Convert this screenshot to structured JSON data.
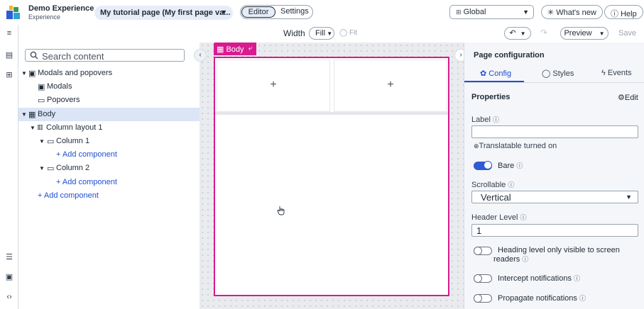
{
  "header": {
    "app_title": "Demo Experience",
    "app_subtitle": "Experience",
    "page_select": "My tutorial page (My first page va...",
    "tabs": [
      "Editor",
      "Settings"
    ],
    "global_select": "Global",
    "whats_new": "What's new",
    "help": "Help"
  },
  "toolbar": {
    "width_label": "Width",
    "width_value": "Fill",
    "fit_label": "Fit",
    "preview": "Preview",
    "save": "Save"
  },
  "tree": {
    "search_placeholder": "Search content",
    "items": [
      {
        "label": "Modals and popovers"
      },
      {
        "label": "Modals"
      },
      {
        "label": "Popovers"
      },
      {
        "label": "Body"
      },
      {
        "label": "Column layout 1"
      },
      {
        "label": "Column 1"
      },
      {
        "label": "+ Add component"
      },
      {
        "label": "Column 2"
      },
      {
        "label": "+ Add component"
      },
      {
        "label": "+ Add component"
      }
    ]
  },
  "canvas": {
    "body_tag": "Body",
    "plus": "+"
  },
  "config": {
    "title": "Page configuration",
    "tabs": [
      "Config",
      "Styles",
      "Events"
    ],
    "properties": "Properties",
    "edit": "Edit",
    "label_label": "Label",
    "label_value": "",
    "translatable": "Translatable turned on",
    "bare_label": "Bare",
    "scrollable_label": "Scrollable",
    "scrollable_value": "Vertical",
    "header_level_label": "Header Level",
    "header_level_value": "1",
    "heading_visible_label": "Heading level only visible to screen readers",
    "intercept_label": "Intercept notifications",
    "propagate_label": "Propagate notifications"
  },
  "colors": {
    "accent": "#1f4fd1",
    "body_highlight": "#d81b8f",
    "toggle_on": "#2f5bd3"
  }
}
